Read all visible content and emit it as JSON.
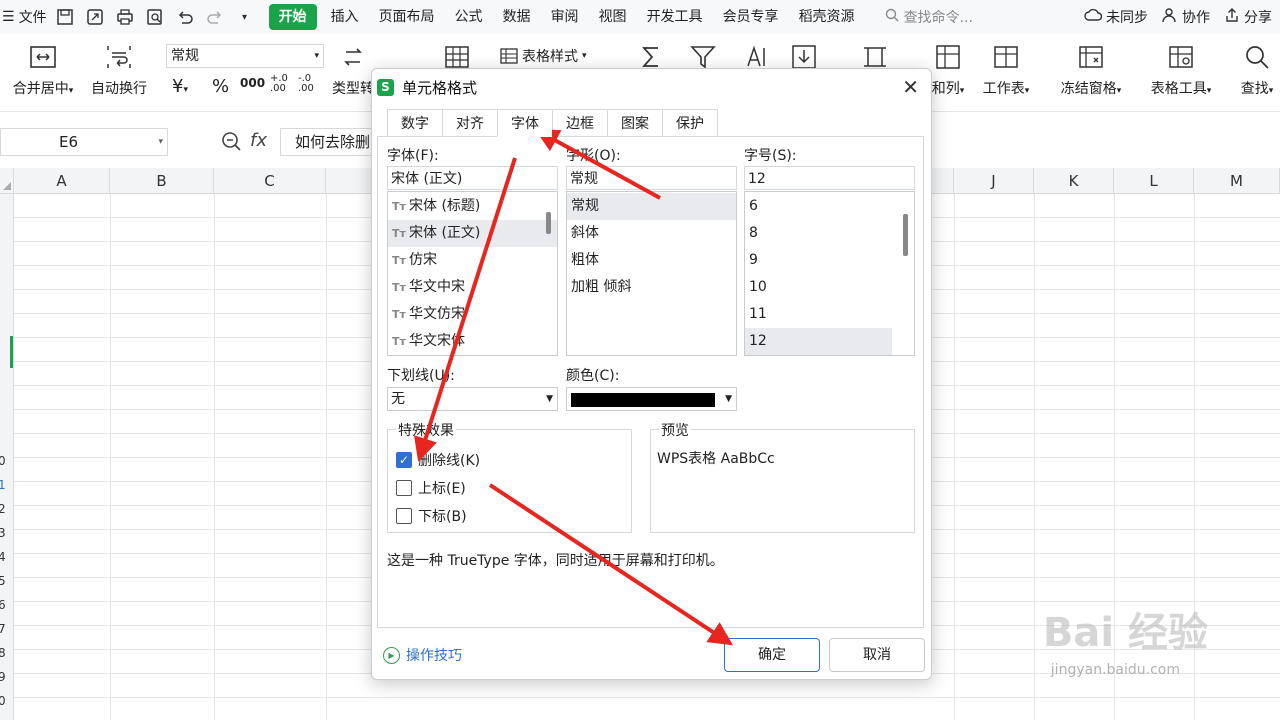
{
  "menubar": {
    "file": "文件",
    "tabs": [
      "开始",
      "插入",
      "页面布局",
      "公式",
      "数据",
      "审阅",
      "视图",
      "开发工具",
      "会员专享",
      "稻壳资源"
    ],
    "search": "查找命令...",
    "sync": "未同步",
    "collab": "协作",
    "share": "分享"
  },
  "ribbon": {
    "merge": "合并居中",
    "wrap": "自动换行",
    "numformat": "常规",
    "currency": "¥",
    "percent": "%",
    "thousands": "000",
    "inc_decimal": "+.0\n.00",
    "dec_decimal": "-.0\n.00",
    "typeconv": "类型转",
    "table_style": "表格样式",
    "rowcol": "和列",
    "worksheet": "工作表",
    "freeze": "冻结窗格",
    "table_tools": "表格工具",
    "find": "查找"
  },
  "formula_bar": {
    "cell_ref": "E6",
    "fx": "fx",
    "content": "如何去除删"
  },
  "columns": [
    "A",
    "B",
    "C",
    "J",
    "K",
    "L",
    "M"
  ],
  "rows": [
    "0",
    "1",
    "2",
    "3",
    "4",
    "5",
    "6",
    "7",
    "8",
    "9",
    "0"
  ],
  "dialog": {
    "title": "单元格格式",
    "tabs": [
      "数字",
      "对齐",
      "字体",
      "边框",
      "图案",
      "保护"
    ],
    "font_label": "字体(F):",
    "font_value": "宋体 (正文)",
    "font_list": [
      "宋体 (标题)",
      "宋体 (正文)",
      "仿宋",
      "华文中宋",
      "华文仿宋",
      "华文宋体"
    ],
    "style_label": "字形(O):",
    "style_value": "常规",
    "style_list": [
      "常规",
      "斜体",
      "粗体",
      "加粗 倾斜"
    ],
    "size_label": "字号(S):",
    "size_value": "12",
    "size_list": [
      "6",
      "8",
      "9",
      "10",
      "11",
      "12"
    ],
    "underline_label": "下划线(U):",
    "underline_value": "无",
    "color_label": "颜色(C):",
    "color_value": "#000000",
    "effects_label": "特殊效果",
    "strikethrough": "删除线(K)",
    "superscript": "上标(E)",
    "subscript": "下标(B)",
    "preview_label": "预览",
    "preview_sample": "WPS表格  AaBbCc",
    "description": "这是一种 TrueType 字体，同时适用于屏幕和打印机。",
    "tips": "操作技巧",
    "ok": "确定",
    "cancel": "取消"
  },
  "state": {
    "strikethrough_checked": true,
    "superscript_checked": false,
    "subscript_checked": false
  },
  "watermark": {
    "brand": "Bai 经验",
    "url": "jingyan.baidu.com"
  },
  "colors": {
    "accent_green": "#1aa34a",
    "checkbox_blue": "#2e6fd3",
    "annotation_red": "#e8251f"
  }
}
